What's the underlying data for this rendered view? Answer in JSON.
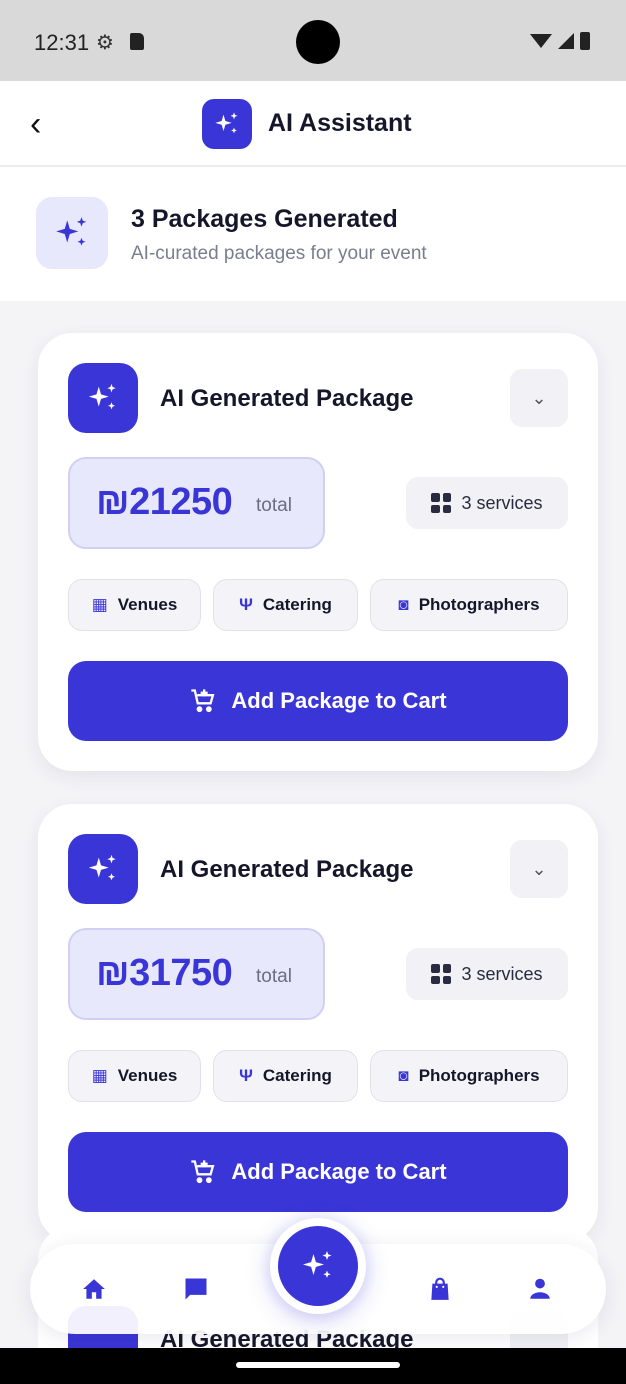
{
  "status_bar": {
    "time": "12:31"
  },
  "header": {
    "title": "AI Assistant"
  },
  "summary": {
    "title": "3 Packages Generated",
    "subtitle": "AI-curated packages for your event"
  },
  "packages": [
    {
      "title": "AI Generated Package",
      "price": "₪21250",
      "price_suffix": "total",
      "services": "3 services",
      "chips": [
        "Venues",
        "Catering",
        "Photographers"
      ],
      "cta": "Add Package to Cart"
    },
    {
      "title": "AI Generated Package",
      "price": "₪31750",
      "price_suffix": "total",
      "services": "3 services",
      "chips": [
        "Venues",
        "Catering",
        "Photographers"
      ],
      "cta": "Add Package to Cart"
    },
    {
      "title": "AI Generated Package"
    }
  ],
  "bottom_nav": {
    "items": [
      "home-icon",
      "chat-icon",
      "sparkle-icon",
      "bag-icon",
      "person-icon"
    ]
  },
  "colors": {
    "accent": "#3a35d6",
    "accent_light": "#e7e8fb"
  }
}
